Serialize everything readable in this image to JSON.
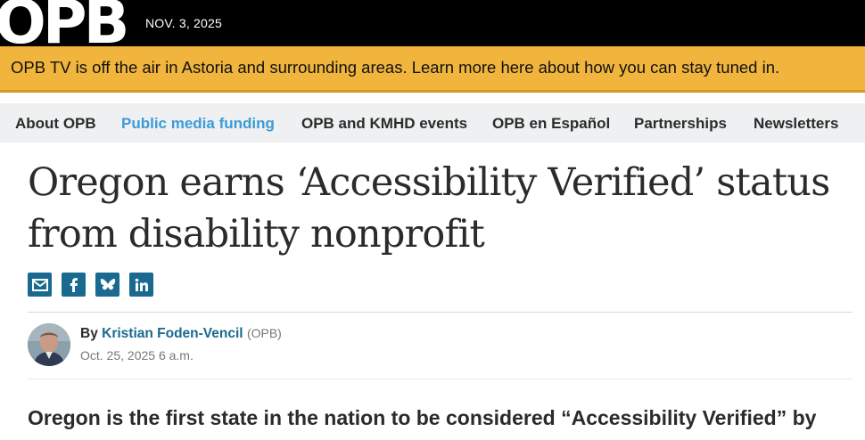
{
  "header": {
    "logo": "OPB",
    "date": "NOV. 3, 2025"
  },
  "alert": {
    "text": "OPB TV is off the air in Astoria and surrounding areas. Learn more here about how you can stay tuned in."
  },
  "nav": {
    "items": [
      {
        "label": "About OPB"
      },
      {
        "label": "Public media funding"
      },
      {
        "label": "OPB and KMHD events"
      },
      {
        "label": "OPB en Español"
      },
      {
        "label": "Partnerships"
      },
      {
        "label": "Newsletters"
      }
    ]
  },
  "article": {
    "title": "Oregon earns ‘Accessibility Verified’ status from disability nonprofit",
    "by": "By",
    "author": "Kristian Foden-Vencil",
    "org": "(OPB)",
    "date": "Oct. 25, 2025 6 a.m.",
    "lede": "Oregon is the first state in the nation to be considered “Accessibility Verified” by"
  },
  "share_icons": [
    "email-icon",
    "facebook-icon",
    "bluesky-icon",
    "linkedin-icon"
  ],
  "colors": {
    "alert": "#f1b53e",
    "accent": "#1a6a8f",
    "nav_active": "#3c9bd6",
    "nav_bg": "#eef0f1"
  }
}
